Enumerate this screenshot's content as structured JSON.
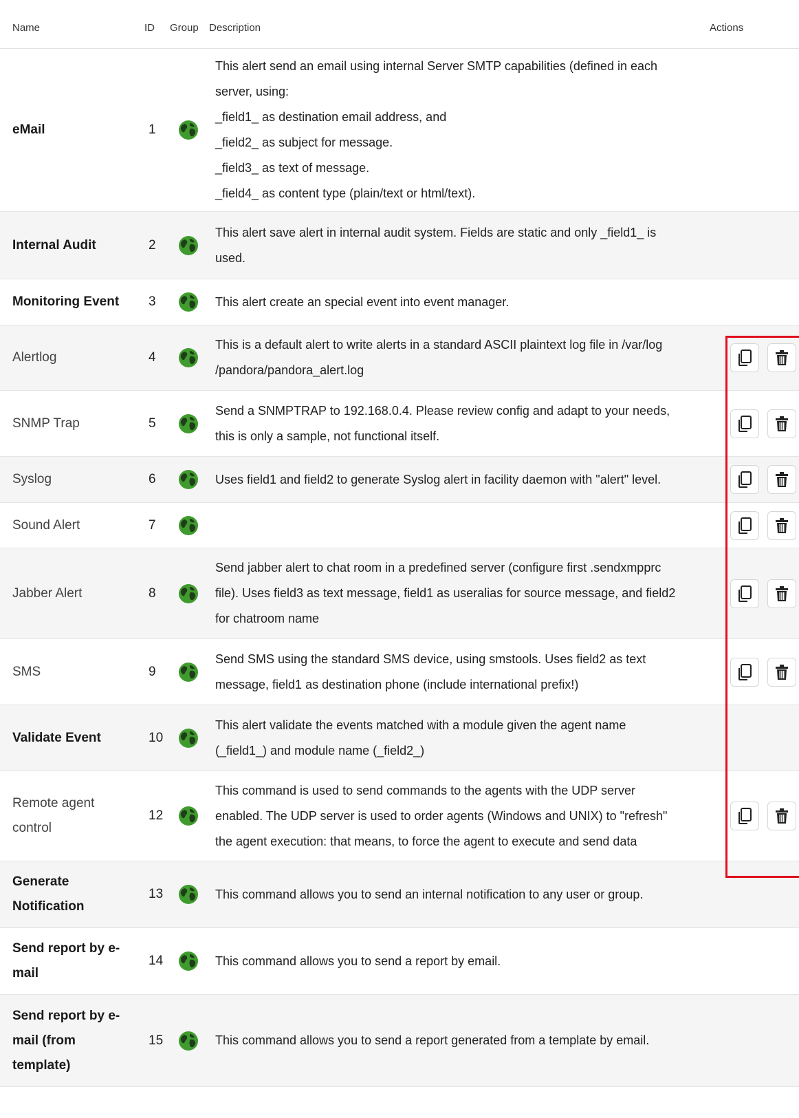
{
  "headers": {
    "name": "Name",
    "id": "ID",
    "group": "Group",
    "description": "Description",
    "actions": "Actions"
  },
  "rows": [
    {
      "name": "eMail",
      "id": "1",
      "bold": true,
      "actions": false,
      "description": "This alert send an email using internal Server SMTP capabilities (defined in each\nserver, using:\n_field1_ as destination email address, and\n_field2_ as subject for message.\n_field3_ as text of message.\n_field4_ as content type (plain/text or html/text)."
    },
    {
      "name": "Internal Audit",
      "id": "2",
      "bold": true,
      "actions": false,
      "description": "This alert save alert in internal audit system. Fields are static and only _field1_ is\nused."
    },
    {
      "name": "Monitoring Event",
      "id": "3",
      "bold": true,
      "actions": false,
      "description": "This alert create an special event into event manager."
    },
    {
      "name": "Alertlog",
      "id": "4",
      "bold": false,
      "actions": true,
      "description": "This is a default alert to write alerts in a standard ASCII plaintext log file in /var/log\n/pandora/pandora_alert.log"
    },
    {
      "name": "SNMP Trap",
      "id": "5",
      "bold": false,
      "actions": true,
      "description": "Send a SNMPTRAP to 192.168.0.4. Please review config and adapt to your needs,\nthis is only a sample, not functional itself."
    },
    {
      "name": "Syslog",
      "id": "6",
      "bold": false,
      "actions": true,
      "description": "Uses field1 and field2 to generate Syslog alert in facility daemon with \"alert\" level."
    },
    {
      "name": "Sound Alert",
      "id": "7",
      "bold": false,
      "actions": true,
      "description": ""
    },
    {
      "name": "Jabber Alert",
      "id": "8",
      "bold": false,
      "actions": true,
      "description": "Send jabber alert to chat room in a predefined server (configure first .sendxmpprc\nfile). Uses field3 as text message, field1 as useralias for source message, and field2\nfor chatroom name"
    },
    {
      "name": "SMS",
      "id": "9",
      "bold": false,
      "actions": true,
      "description": "Send SMS using the standard SMS device, using smstools. Uses field2 as text\nmessage, field1 as destination phone (include international prefix!)"
    },
    {
      "name": "Validate Event",
      "id": "10",
      "bold": true,
      "actions": false,
      "description": "This alert validate the events matched with a module given the agent name\n(_field1_) and module name (_field2_)"
    },
    {
      "name": "Remote agent control",
      "id": "12",
      "bold": false,
      "actions": true,
      "description": "This command is used to send commands to the agents with the UDP server\nenabled. The UDP server is used to order agents (Windows and UNIX) to \"refresh\"\nthe agent execution: that means, to force the agent to execute and send data"
    },
    {
      "name": "Generate Notification",
      "id": "13",
      "bold": true,
      "actions": false,
      "description": "This command allows you to send an internal notification to any user or group."
    },
    {
      "name": "Send report by e-mail",
      "id": "14",
      "bold": true,
      "actions": false,
      "description": "This command allows you to send a report by email."
    },
    {
      "name": "Send report by e-mail (from template)",
      "id": "15",
      "bold": true,
      "actions": false,
      "description": "This command allows you to send a report generated from a template by email."
    }
  ],
  "icons": {
    "group": "globe-icon",
    "copy": "copy-icon",
    "delete": "trash-icon"
  },
  "colors": {
    "globe_green": "#3f9b2d",
    "globe_land": "#1f3d1a",
    "highlight": "#e0101e",
    "row_alt": "#f5f5f5"
  }
}
